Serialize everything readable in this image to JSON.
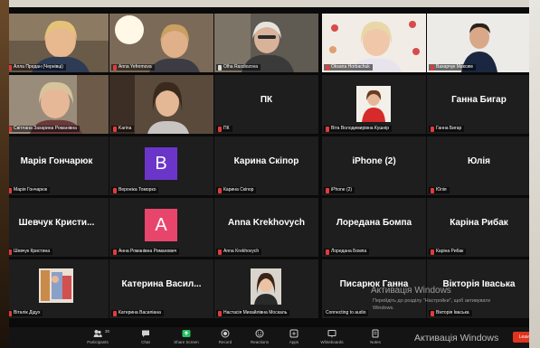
{
  "tiles": [
    {
      "label": "Алла Предан (Чернівці)"
    },
    {
      "label": "Anna Yefremova"
    },
    {
      "label": "Olha Rasdiozova"
    },
    {
      "label": "Oksana Horbachuk"
    },
    {
      "label": "Вахарчук Максим"
    },
    {
      "label": "Світлана Захарина Романівна"
    },
    {
      "label": "Karina"
    },
    {
      "name": "ПК",
      "label": "ПК"
    },
    {
      "label": "Віта Володимирівна Кушнір"
    },
    {
      "name": "Ганна Бигар",
      "label": "Ганна Бигар"
    },
    {
      "name": "Марія Гончарюк",
      "label": "Марія Гончарюк"
    },
    {
      "avatar": "B",
      "label": "Вероніка Томорко"
    },
    {
      "name": "Карина Скіпор",
      "label": "Карина Скіпор"
    },
    {
      "name": "iPhone (2)",
      "label": "iPhone (2)"
    },
    {
      "name": "Юлія",
      "label": "Юлія"
    },
    {
      "name": "Шевчук Кристи...",
      "label": "Шевчук Кристина"
    },
    {
      "avatar": "A",
      "label": "Анна Романівна Романович"
    },
    {
      "name": "Anna Krekhovych",
      "label": "Anna Krekhovych"
    },
    {
      "name": "Лоредана Бомпа",
      "label": "Лоредана Бомпа"
    },
    {
      "name": "Каріна Рибак",
      "label": "Каріна Рибак"
    },
    {
      "label": "Віталік Дідух"
    },
    {
      "name": "Катерина Васил...",
      "label": "Катерина Василіана"
    },
    {
      "label": "Настасія Михайлівна Москаль"
    },
    {
      "name": "Писарюк Ганна",
      "label": "Connecting to audio"
    },
    {
      "name": "Вікторія Іваськa",
      "label": "Вікторія Іваськa"
    }
  ],
  "toolbar": {
    "participants": "Participants",
    "participants_count": "30",
    "chat": "Chat",
    "share": "Share Screen",
    "record": "Record",
    "reactions": "Reactions",
    "apps": "Apps",
    "whiteboards": "Whiteboards",
    "notes": "Notes",
    "leave": "Leave"
  },
  "watermark": {
    "title_center": "Активація Windows",
    "line1": "Перейдіть до розділу \"Настройки\", щоб активувати",
    "line2": "Windows.",
    "title_bottom": "Активація Windows"
  },
  "colors": {
    "active_border": "#c7d94a",
    "avatar_b": "#6b35c9",
    "avatar_a": "#e8456d",
    "leave": "#e0341e",
    "share_green": "#26c262"
  }
}
